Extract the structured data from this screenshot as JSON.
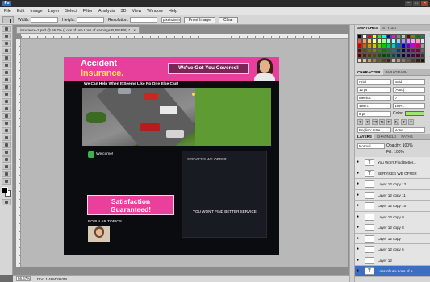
{
  "window": {
    "app_logo": "Ps",
    "min": "–",
    "max": "□",
    "close": "✕"
  },
  "menu": [
    "File",
    "Edit",
    "Image",
    "Layer",
    "Select",
    "Filter",
    "Analysis",
    "3D",
    "View",
    "Window",
    "Help"
  ],
  "options_bar": {
    "width_label": "Width:",
    "height_label": "Height:",
    "resolution_label": "Resolution:",
    "unit_value": "pixels/inch",
    "front_image_label": "Front Image",
    "clear_label": "Clear"
  },
  "document": {
    "tab_title": "insurance-1.psd @ 66.7% (Loss of use Loss of earnings P, RGB/8) *",
    "tab_close": "×",
    "zoom": "66.67%",
    "doc_info": "Doc: 1.48M/26.0M"
  },
  "design": {
    "logo_line1": "Accident",
    "logo_line2": "Insurance.",
    "tagline": "We've Got You Covered!",
    "banner_text": "We Can Help When It Seems Like No One Else Can!",
    "welcome": "Welcome!",
    "cta_line1": "Satisfaction",
    "cta_line2": "Guaranteed!",
    "popular_topics": "POPULAR TOPICS",
    "services_title": "SERVICES WE OFFER",
    "services_note": "YOU WON'T FIND BETTER SERVICE!",
    "colors": {
      "pink": "#e63f9c",
      "yellow": "#ffe15a",
      "dark": "#0a0c10"
    }
  },
  "panels": {
    "swatches_tab": "SWATCHES",
    "styles_tab": "STYLES",
    "swatch_colors": [
      "#000000",
      "#ffffff",
      "#ff0000",
      "#ffff00",
      "#00ff00",
      "#00ffff",
      "#0000ff",
      "#ff00ff",
      "#7f7f7f",
      "#c0c0c0",
      "#800000",
      "#808000",
      "#008000",
      "#008080",
      "#ff4d4d",
      "#ff9966",
      "#ffcc66",
      "#ffff99",
      "#ccff99",
      "#99ff99",
      "#99ffcc",
      "#99ffff",
      "#99ccff",
      "#9999ff",
      "#cc99ff",
      "#ff99ff",
      "#ff99cc",
      "#e6e6e6",
      "#cc0000",
      "#cc6600",
      "#cc9900",
      "#cccc00",
      "#66cc00",
      "#00cc00",
      "#00cc66",
      "#00cccc",
      "#0066cc",
      "#0000cc",
      "#6600cc",
      "#cc00cc",
      "#cc0066",
      "#999999",
      "#800000",
      "#804000",
      "#806600",
      "#808000",
      "#408000",
      "#008000",
      "#008040",
      "#008080",
      "#004080",
      "#000080",
      "#400080",
      "#800080",
      "#800040",
      "#666666",
      "#4d0000",
      "#4d2600",
      "#4d3d00",
      "#4d4d00",
      "#264d00",
      "#004d00",
      "#004d26",
      "#004d4d",
      "#00264d",
      "#00004d",
      "#26004d",
      "#4d004d",
      "#4d0026",
      "#333333",
      "#f2d7c4",
      "#e8c09a",
      "#c49a6c",
      "#a0764a",
      "#7a5533",
      "#5a3d24",
      "#3d2817",
      "#c8b7a6",
      "#a89684",
      "#887766",
      "#685848",
      "#4a3d30",
      "#2e241b",
      "#1a1410"
    ],
    "character_tab": "CHARACTER",
    "paragraph_tab": "PARAGRAPH",
    "font_family": "Arial",
    "font_style": "Bold",
    "font_size": "12 pt",
    "leading": "(Auto)",
    "tracking": "0",
    "kerning": "Metrics",
    "vscale": "100%",
    "hscale": "100%",
    "baseline": "0 pt",
    "color_label": "Color:",
    "language": "English: USA",
    "antialias": "None",
    "layers_tab": "LAYERS",
    "channels_tab": "CHANNELS",
    "paths_tab": "PATHS",
    "blend_mode": "Normal",
    "opacity": "Opacity: 100%",
    "fill": "Fill: 100%",
    "layers": [
      {
        "type": "T",
        "name": "You Won't Find Better...",
        "selected": false
      },
      {
        "type": "T",
        "name": "SERVICES WE OFFER",
        "selected": false
      },
      {
        "type": "",
        "name": "Layer 12 copy 12",
        "selected": false
      },
      {
        "type": "",
        "name": "Layer 12 copy 11",
        "selected": false
      },
      {
        "type": "",
        "name": "Layer 12 copy 10",
        "selected": false
      },
      {
        "type": "",
        "name": "Layer 12 copy 9",
        "selected": false
      },
      {
        "type": "",
        "name": "Layer 12 copy 8",
        "selected": false
      },
      {
        "type": "",
        "name": "Layer 12 copy 7",
        "selected": false
      },
      {
        "type": "",
        "name": "Layer 12 copy 6",
        "selected": false
      },
      {
        "type": "",
        "name": "Layer 12",
        "selected": false
      },
      {
        "type": "T",
        "name": "Loss of use Loss of e...",
        "selected": true
      }
    ]
  }
}
